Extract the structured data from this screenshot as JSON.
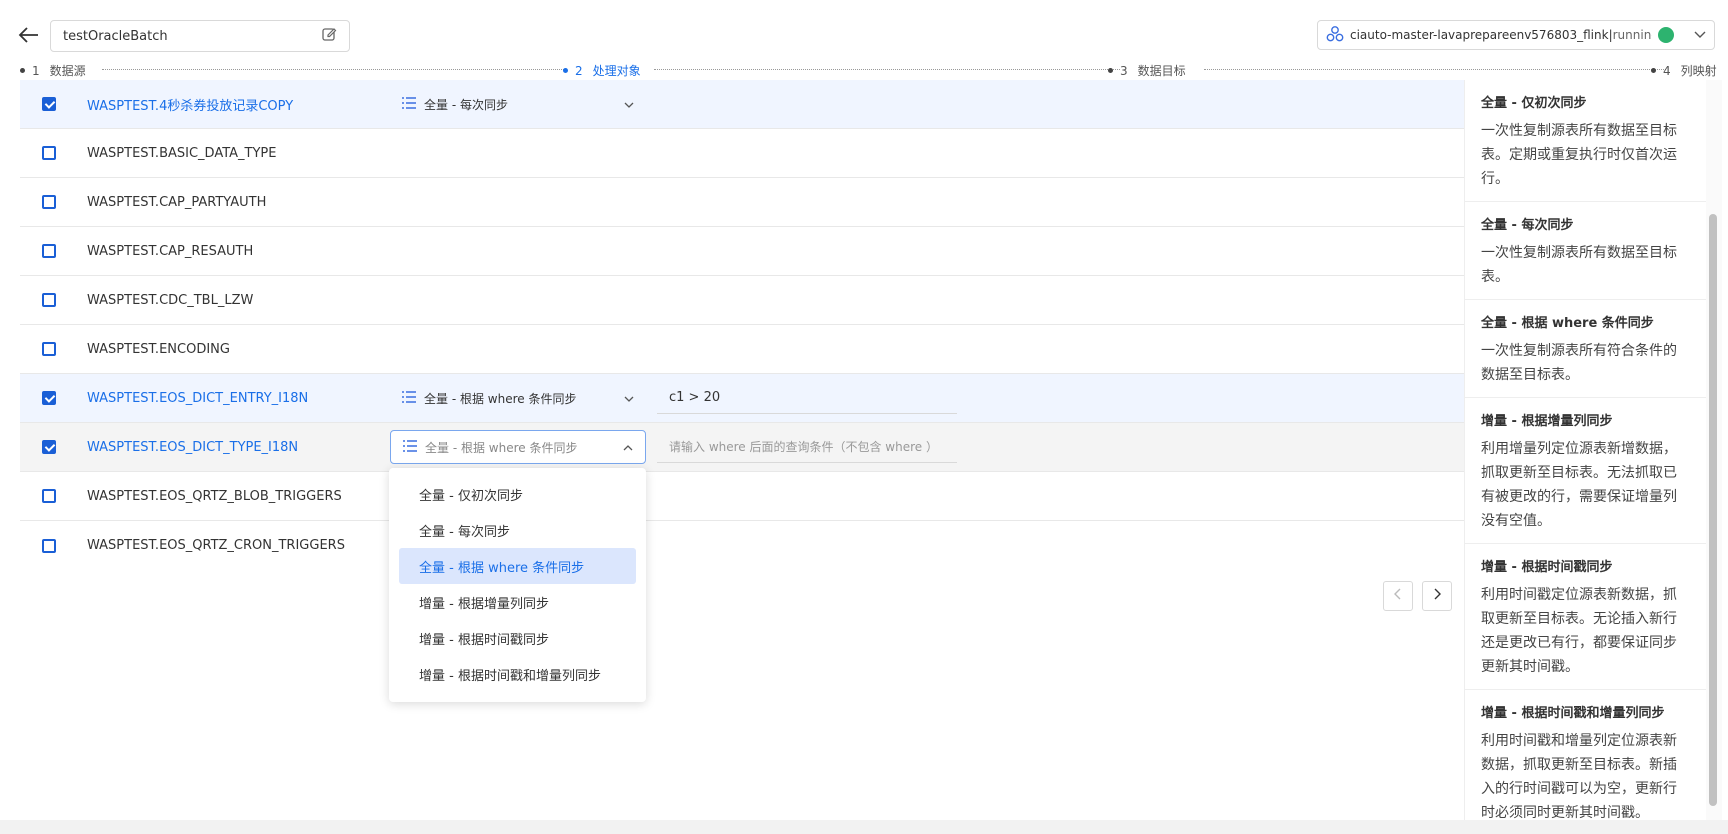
{
  "header": {
    "task_name": "testOracleBatch",
    "cluster": "ciauto-master-lavaprepareenv576803_flink",
    "status": "running"
  },
  "steps": [
    {
      "num": "1",
      "label": "数据源"
    },
    {
      "num": "2",
      "label": "处理对象"
    },
    {
      "num": "3",
      "label": "数据目标"
    },
    {
      "num": "4",
      "label": "列映射"
    }
  ],
  "rows": [
    {
      "name": "WASPTEST.4秒杀券投放记录COPY",
      "checked": true,
      "mode": "全量 - 每次同步",
      "condition": ""
    },
    {
      "name": "WASPTEST.BASIC_DATA_TYPE",
      "checked": false
    },
    {
      "name": "WASPTEST.CAP_PARTYAUTH",
      "checked": false
    },
    {
      "name": "WASPTEST.CAP_RESAUTH",
      "checked": false
    },
    {
      "name": "WASPTEST.CDC_TBL_LZW",
      "checked": false
    },
    {
      "name": "WASPTEST.ENCODING",
      "checked": false
    },
    {
      "name": "WASPTEST.EOS_DICT_ENTRY_I18N",
      "checked": true,
      "mode": "全量 - 根据 where 条件同步",
      "condition": "c1 > 20"
    },
    {
      "name": "WASPTEST.EOS_DICT_TYPE_I18N",
      "checked": true,
      "mode": "全量 - 根据 where 条件同步",
      "condition_placeholder": "请输入 where 后面的查询条件（不包含 where ）"
    },
    {
      "name": "WASPTEST.EOS_QRTZ_BLOB_TRIGGERS",
      "checked": false
    },
    {
      "name": "WASPTEST.EOS_QRTZ_CRON_TRIGGERS",
      "checked": false
    }
  ],
  "dropdown_options": [
    "全量 - 仅初次同步",
    "全量 - 每次同步",
    "全量 - 根据 where 条件同步",
    "增量 - 根据增量列同步",
    "增量 - 根据时间戳同步",
    "增量 - 根据时间戳和增量列同步"
  ],
  "dropdown_selected_index": 2,
  "help": [
    {
      "title": "全量 - 仅初次同步",
      "text": "一次性复制源表所有数据至目标表。定期或重复执行时仅首次运行。"
    },
    {
      "title": "全量 - 每次同步",
      "text": "一次性复制源表所有数据至目标表。"
    },
    {
      "title": "全量 - 根据 where 条件同步",
      "text": "一次性复制源表所有符合条件的数据至目标表。"
    },
    {
      "title": "增量 - 根据增量列同步",
      "text": "利用增量列定位源表新增数据，抓取更新至目标表。无法抓取已有被更改的行，需要保证增量列没有空值。"
    },
    {
      "title": "增量 - 根据时间戳同步",
      "text": "利用时间戳定位源表新数据，抓取更新至目标表。无论插入新行还是更改已有行，都要保证同步更新其时间戳。"
    },
    {
      "title": "增量 - 根据时间戳和增量列同步",
      "text": "利用时间戳和增量列定位源表新数据，抓取更新至目标表。新插入的行时间戳可以为空，更新行时必须同时更新其时间戳。"
    }
  ],
  "colors": {
    "accent": "#1a6fe8",
    "checkbox": "#1a5fd6",
    "running": "#2db36f"
  }
}
